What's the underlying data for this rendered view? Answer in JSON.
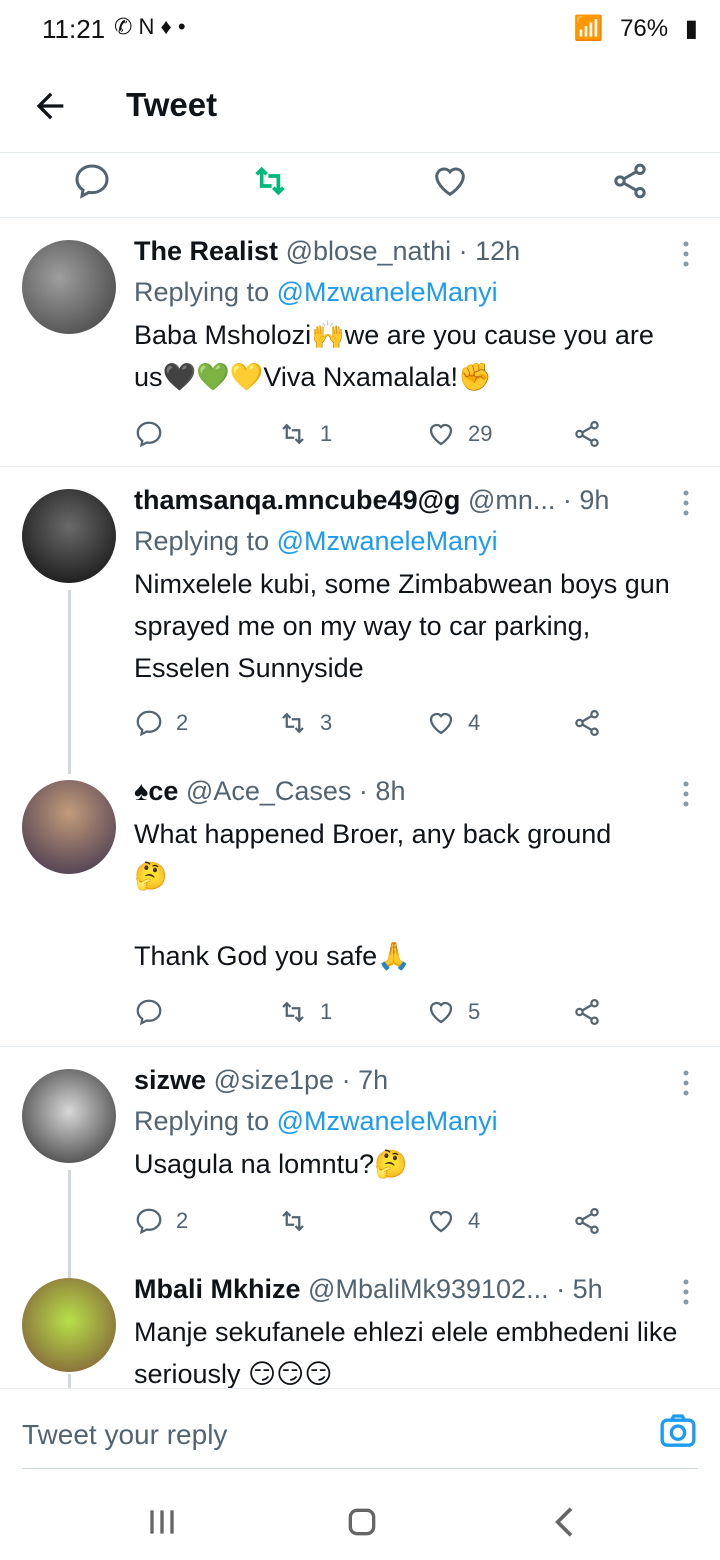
{
  "status": {
    "time": "11:21",
    "left_icons": "✆ N ♦ •",
    "battery": "76%"
  },
  "header": {
    "title": "Tweet"
  },
  "tweets": [
    {
      "name": "The Realist",
      "handle": "@blose_nathi",
      "time": "12h",
      "replying_to_prefix": "Replying to",
      "replying_to": "@MzwaneleManyi",
      "text": "Baba Msholozi🙌we are you cause you are us🖤💚💛Viva Nxamalala!✊",
      "replies": "",
      "retweets": "1",
      "likes": "29"
    },
    {
      "name": "thamsanqa.mncube49@g",
      "handle": "@mn...",
      "time": "9h",
      "replying_to_prefix": "Replying to",
      "replying_to": "@MzwaneleManyi",
      "text": "Nimxelele kubi, some Zimbabwean boys gun sprayed me on my way to car parking, Esselen Sunnyside",
      "replies": "2",
      "retweets": "3",
      "likes": "4"
    },
    {
      "name": "♠ce",
      "handle": "@Ace_Cases",
      "time": "8h",
      "text_1": "What happened Broer, any back ground",
      "text_2": "🤔",
      "text_3": "Thank God you safe🙏",
      "replies": "",
      "retweets": "1",
      "likes": "5"
    },
    {
      "name": "sizwe",
      "handle": "@size1pe",
      "time": "7h",
      "replying_to_prefix": "Replying to",
      "replying_to": "@MzwaneleManyi",
      "text": "Usagula na lomntu?🤔",
      "replies": "2",
      "retweets": "",
      "likes": "4"
    },
    {
      "name": "Mbali Mkhize",
      "handle": "@MbaliMk939102...",
      "time": "5h",
      "text": "Manje sekufanele ehlezi elele embhedeni like seriously 😏😏😏"
    }
  ],
  "composer": {
    "placeholder": "Tweet your reply"
  },
  "colors": {
    "accent": "#1d9bf0",
    "retweet_green": "#00ba7c",
    "muted": "#536471"
  }
}
